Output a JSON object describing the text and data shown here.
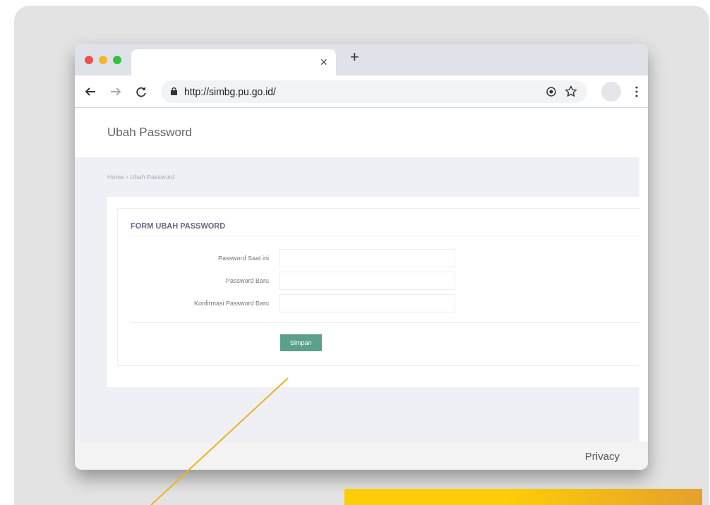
{
  "browser": {
    "tab_close": "×",
    "new_tab": "+",
    "url": "http://simbg.pu.go.id/"
  },
  "page": {
    "title": "Ubah Password",
    "breadcrumb": "Home › Ubah Password",
    "form": {
      "title": "FORM UBAH PASSWORD",
      "fields": [
        {
          "label": "Password Saat ini"
        },
        {
          "label": "Password Baru"
        },
        {
          "label": "Konfirmasi Password Baru"
        }
      ],
      "submit": "Simpan"
    }
  },
  "footer": {
    "links": [
      "Privacy"
    ]
  }
}
